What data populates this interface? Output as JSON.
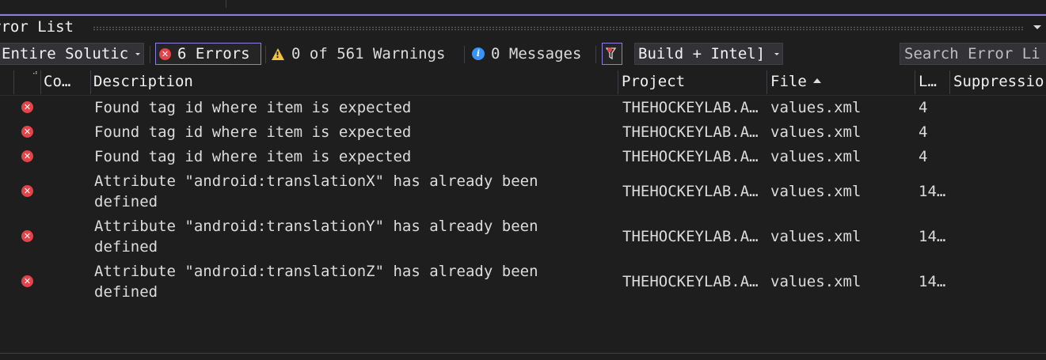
{
  "panel": {
    "title": "rror List"
  },
  "toolbar": {
    "scope": "Entire Solutic",
    "errors_label": "6 Errors",
    "warnings_label": "0 of 561 Warnings",
    "messages_label": "0 Messages",
    "build_filter": "Build + Intel]",
    "search_placeholder": "Search Error Li"
  },
  "columns": {
    "code": "Co…",
    "description": "Description",
    "project": "Project",
    "file": "File",
    "line": "L…",
    "suppression": "Suppressio"
  },
  "rows": [
    {
      "description": "Found tag id where item is expected",
      "project": "THEHOCKEYLAB.A…",
      "file": "values.xml",
      "line": "4"
    },
    {
      "description": "Found tag id where item is expected",
      "project": "THEHOCKEYLAB.A…",
      "file": "values.xml",
      "line": "4"
    },
    {
      "description": "Found tag id where item is expected",
      "project": "THEHOCKEYLAB.A…",
      "file": "values.xml",
      "line": "4"
    },
    {
      "description": "Attribute \"android:translationX\" has already been defined",
      "project": "THEHOCKEYLAB.A…",
      "file": "values.xml",
      "line": "14…"
    },
    {
      "description": "Attribute \"android:translationY\" has already been defined",
      "project": "THEHOCKEYLAB.A…",
      "file": "values.xml",
      "line": "14…"
    },
    {
      "description": "Attribute \"android:translationZ\" has already been defined",
      "project": "THEHOCKEYLAB.A…",
      "file": "values.xml",
      "line": "14…"
    }
  ],
  "colors": {
    "background": "#1e1e1e",
    "accent": "#8a7ee0",
    "error": "#e5434a",
    "warning": "#f2c341",
    "info": "#3794ff"
  }
}
